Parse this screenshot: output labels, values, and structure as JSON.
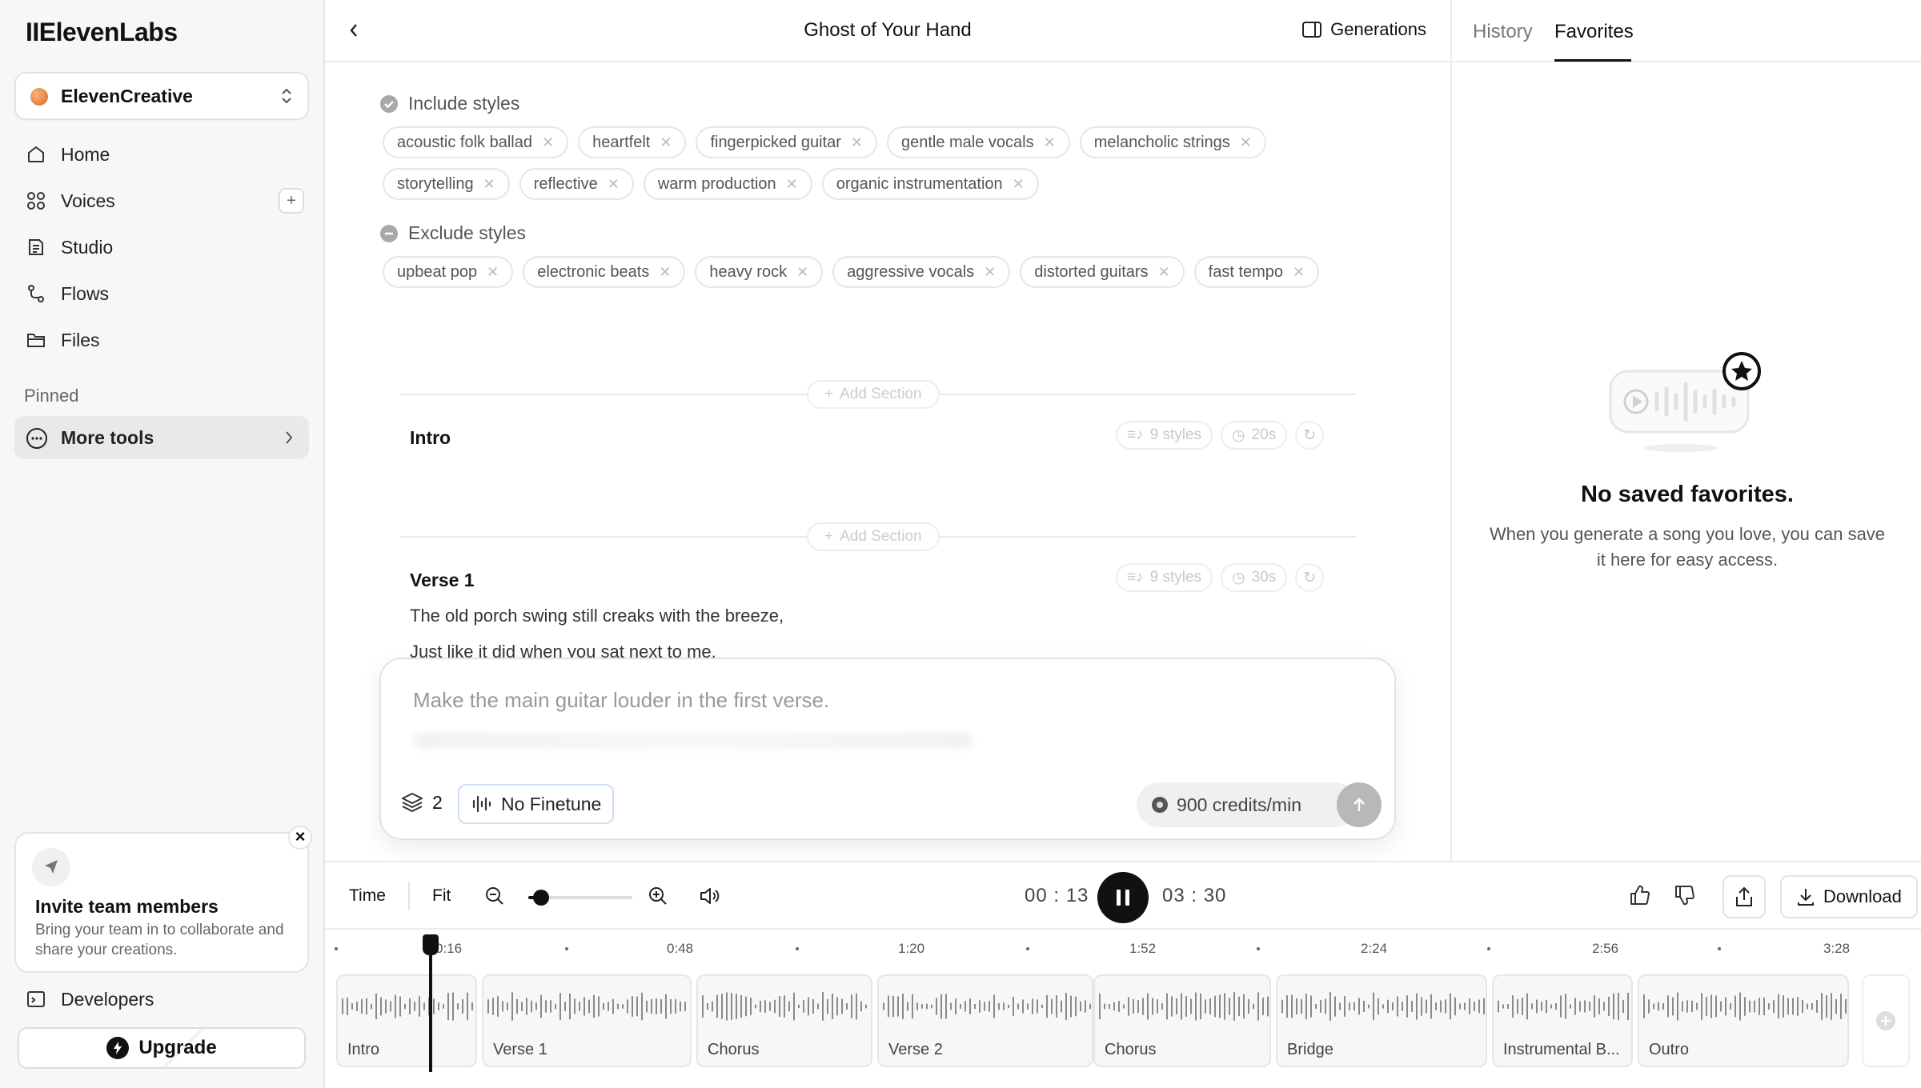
{
  "app": {
    "logo": "IIElevenLabs"
  },
  "workspace": {
    "name": "ElevenCreative"
  },
  "sidebar": {
    "items": [
      {
        "label": "Home",
        "icon": "home-icon"
      },
      {
        "label": "Voices",
        "icon": "voices-icon"
      },
      {
        "label": "Studio",
        "icon": "studio-icon"
      },
      {
        "label": "Flows",
        "icon": "flows-icon"
      },
      {
        "label": "Files",
        "icon": "files-icon"
      }
    ],
    "voices_add": "+",
    "pinned_label": "Pinned",
    "more_tools": "More tools",
    "invite": {
      "title": "Invite team members",
      "text": "Bring your team in to collaborate and share your creations.",
      "close": "×"
    },
    "developers": "Developers",
    "upgrade": "Upgrade"
  },
  "header": {
    "title": "Ghost of Your Hand",
    "generations": "Generations"
  },
  "right_panel": {
    "tabs": [
      "History",
      "Favorites"
    ],
    "active_tab": "Favorites",
    "empty_title": "No saved favorites.",
    "empty_text": "When you generate a song you love, you can save it here for easy access."
  },
  "styles": {
    "include_label": "Include styles",
    "include": [
      "acoustic folk ballad",
      "heartfelt",
      "fingerpicked guitar",
      "gentle male vocals",
      "melancholic strings",
      "storytelling",
      "reflective",
      "warm production",
      "organic instrumentation"
    ],
    "exclude_label": "Exclude styles",
    "exclude": [
      "upbeat pop",
      "electronic beats",
      "heavy rock",
      "aggressive vocals",
      "distorted guitars",
      "fast tempo"
    ]
  },
  "add_section_label": "Add Section",
  "sections": [
    {
      "title": "Intro",
      "styles": "9 styles",
      "duration": "20s",
      "lyrics": []
    },
    {
      "title": "Verse 1",
      "styles": "9 styles",
      "duration": "30s",
      "lyrics": [
        "The old porch swing still creaks with the breeze,",
        "Just like it did when you sat next to me."
      ]
    }
  ],
  "prompt": {
    "placeholder": "Make the main guitar louder in the first verse.",
    "layers": "2",
    "finetune": "No Finetune",
    "credits": "900 credits/min"
  },
  "player": {
    "time_label": "Time",
    "fit_label": "Fit",
    "zoom_level": 0.12,
    "current_time": "00 : 13",
    "total_time": "03 : 30",
    "download": "Download"
  },
  "timeline": {
    "ruler": [
      "0:16",
      "0:48",
      "1:20",
      "1:52",
      "2:24",
      "2:56",
      "3:28"
    ],
    "clips": [
      "Intro",
      "Verse 1",
      "Chorus",
      "Verse 2",
      "Chorus",
      "Bridge",
      "Instrumental B...",
      "Outro"
    ]
  },
  "colors": {
    "accent": "#111111",
    "finetune_border": "#cfe0f5",
    "workspace_dot": "#e0632a"
  }
}
